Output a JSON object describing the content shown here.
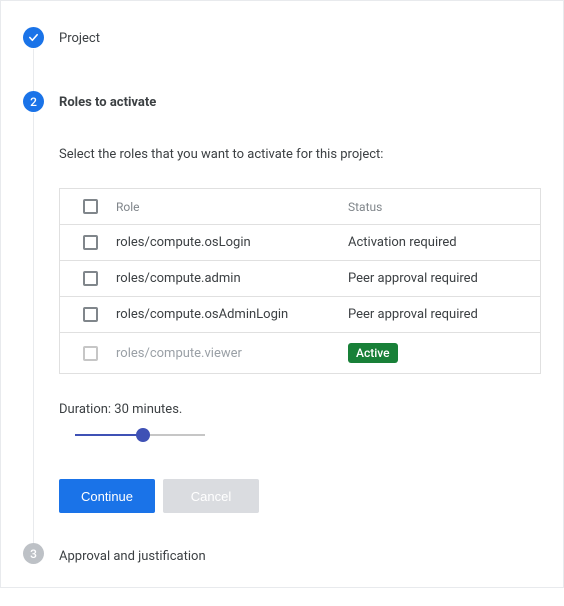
{
  "steps": {
    "s1": {
      "title": "Project"
    },
    "s2": {
      "number": "2",
      "title": "Roles to activate",
      "instruction": "Select the roles that you want to activate for this project:",
      "header": {
        "role": "Role",
        "status": "Status"
      },
      "rows": [
        {
          "role": "roles/compute.osLogin",
          "status": "Activation required"
        },
        {
          "role": "roles/compute.admin",
          "status": "Peer approval required"
        },
        {
          "role": "roles/compute.osAdminLogin",
          "status": "Peer approval required"
        },
        {
          "role": "roles/compute.viewer",
          "status_badge": "Active"
        }
      ],
      "duration_label": "Duration: 30 minutes.",
      "continue": "Continue",
      "cancel": "Cancel"
    },
    "s3": {
      "number": "3",
      "title": "Approval and justification"
    }
  }
}
